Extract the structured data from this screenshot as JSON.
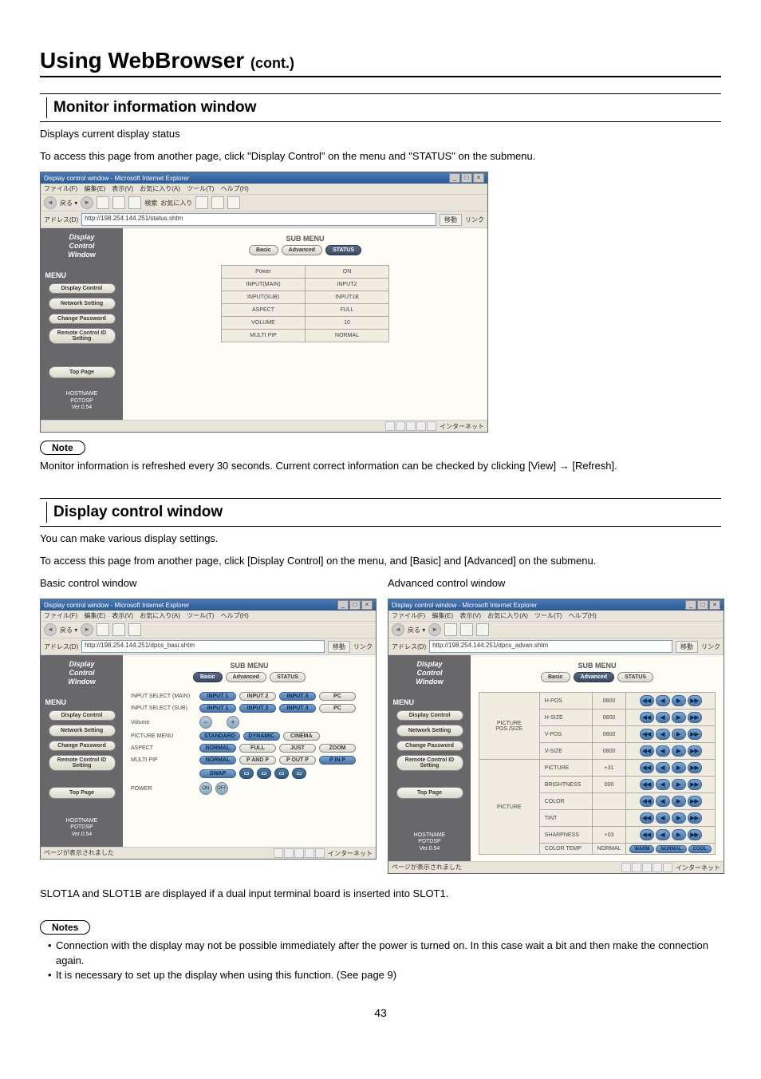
{
  "page_title": {
    "main": "Using WebBrowser ",
    "cont": "(cont.)"
  },
  "section1": {
    "title": "Monitor information window",
    "line1": "Displays current display status",
    "line2": "To access this page from another page, click \"Display Control\" on the menu and \"STATUS\" on the submenu."
  },
  "note1": {
    "label": "Note",
    "text": "Monitor information is refreshed every 30 seconds. Current correct information can be checked by clicking [View] → [Refresh]."
  },
  "section2": {
    "title": "Display control window",
    "line1": "You can make various display settings.",
    "line2": "To access this page from another page, click [Display Control] on the menu, and [Basic] and [Advanced] on the submenu."
  },
  "basic_caption": "Basic control window",
  "advanced_caption": "Advanced control window",
  "slot_text": "SLOT1A and SLOT1B are displayed if a dual input terminal board is inserted into SLOT1.",
  "notes2": {
    "label": "Notes",
    "items": [
      "Connection with the display may not be possible immediately after the power is turned on. In this case wait a bit and then make the connection again.",
      "It is necessary to set up the display when using this function. (See page 9)"
    ]
  },
  "page_number": "43",
  "browser_common": {
    "title": "Display control window - Microsoft Internet Explorer",
    "menu": [
      "ファイル(F)",
      "編集(E)",
      "表示(V)",
      "お気に入り(A)",
      "ツール(T)",
      "ヘルプ(H)"
    ],
    "addr_label": "アドレス(D)",
    "go": "移動",
    "links": "リンク",
    "sidebar": {
      "logo_l1": "Display",
      "logo_l2": "Control",
      "logo_l3": "Window",
      "menu_heading": "MENU",
      "items": [
        "Display Control",
        "Network Setting",
        "Change Password",
        "Remote Control ID Setting"
      ],
      "top": "Top Page",
      "footer_l1": "HOSTNAME",
      "footer_l2": "PDTDSP",
      "footer_l3": "Ver.0.54"
    },
    "sub_menu_title": "SUB MENU",
    "sub_menu": [
      "Basic",
      "Advanced",
      "STATUS"
    ],
    "status_right": "インターネット",
    "status_left": "ページが表示されました"
  },
  "status_window": {
    "url": "http://198.254.144.251/status.shtm",
    "rows": [
      [
        "Power",
        "ON"
      ],
      [
        "INPUT(MAIN)",
        "INPUT2"
      ],
      [
        "INPUT(SUB)",
        "INPUT1B"
      ],
      [
        "ASPECT",
        "FULL"
      ],
      [
        "VOLUME",
        "10"
      ],
      [
        "MULTI PIP",
        "NORMAL"
      ]
    ]
  },
  "basic_window": {
    "url": "http://198.254.144.251/dpcs_basi.shtm",
    "rows": [
      {
        "label": "INPUT SELECT (MAIN)",
        "buttons": [
          "INPUT 1",
          "INPUT 2",
          "INPUT 3",
          "PC"
        ]
      },
      {
        "label": "INPUT SELECT (SUB)",
        "buttons": [
          "INPUT 1",
          "INPUT 2",
          "INPUT 3",
          "PC"
        ]
      },
      {
        "label": "Volume",
        "round": [
          "−",
          "+"
        ]
      },
      {
        "label": "PICTURE MENU",
        "buttons": [
          "STANDARD",
          "DYNAMIC",
          "CINEMA"
        ]
      },
      {
        "label": "ASPECT",
        "buttons": [
          "NORMAL",
          "FULL",
          "JUST",
          "ZOOM"
        ]
      },
      {
        "label": "MULTI PIP",
        "buttons": [
          "NORMAL",
          "P AND P",
          "P OUT P",
          "P IN P"
        ]
      },
      {
        "label": "",
        "buttons_swap": [
          "SWAP"
        ],
        "picons": true
      },
      {
        "label": "POWER",
        "round": [
          "ON",
          "OFF"
        ]
      }
    ]
  },
  "advanced_window": {
    "url": "http://198.254.144.251/dpcs_advan.shtm",
    "groups": [
      {
        "name": "PICTURE POS./SIZE",
        "params": [
          {
            "name": "H-POS",
            "val": "0800"
          },
          {
            "name": "H-SIZE",
            "val": "0800"
          },
          {
            "name": "V-POS",
            "val": "0800"
          },
          {
            "name": "V-SIZE",
            "val": "0800"
          }
        ]
      },
      {
        "name": "PICTURE",
        "params": [
          {
            "name": "PICTURE",
            "val": "+31"
          },
          {
            "name": "BRIGHTNESS",
            "val": "000"
          },
          {
            "name": "COLOR",
            "val": ""
          },
          {
            "name": "TINT",
            "val": ""
          },
          {
            "name": "SHARPNESS",
            "val": "+03"
          },
          {
            "name": "COLOR TEMP",
            "val": "NORMAL",
            "special": [
              "WARM",
              "NORMAL",
              "COOL"
            ]
          }
        ]
      }
    ],
    "arrows": [
      "◀◀",
      "◀",
      "▶",
      "▶▶"
    ]
  }
}
